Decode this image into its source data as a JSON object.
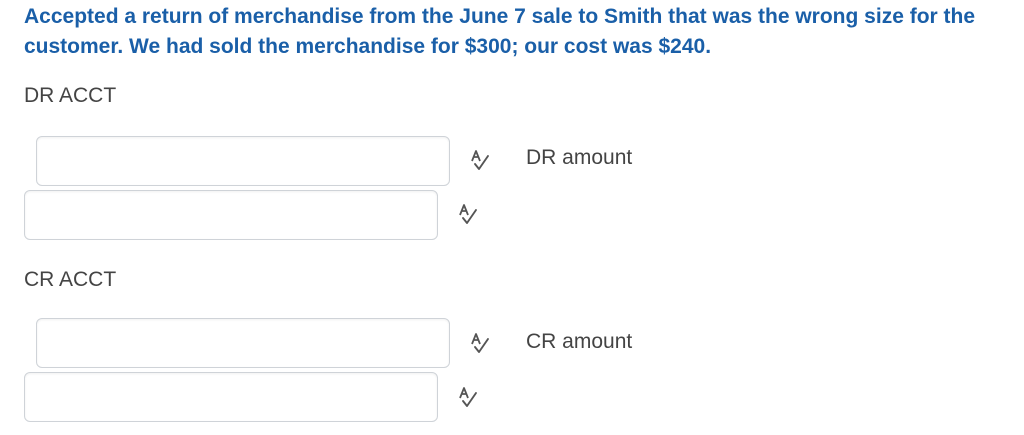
{
  "question": {
    "text": "Accepted a return of merchandise from the June 7 sale to Smith that was the wrong size for the customer. We had sold the merchandise for $300; our cost was $240."
  },
  "debit": {
    "section_label": "DR ACCT",
    "amount_label": "DR amount",
    "rows": [
      {
        "value": ""
      },
      {
        "value": ""
      }
    ]
  },
  "credit": {
    "section_label": "CR ACCT",
    "amount_label": "CR amount",
    "rows": [
      {
        "value": ""
      },
      {
        "value": ""
      }
    ]
  },
  "icons": {
    "spellcheck": "spellcheck-icon"
  },
  "colors": {
    "question_text": "#1a5fa8",
    "label_text": "#444444",
    "input_border": "#cfd3d8",
    "icon": "#555555"
  }
}
